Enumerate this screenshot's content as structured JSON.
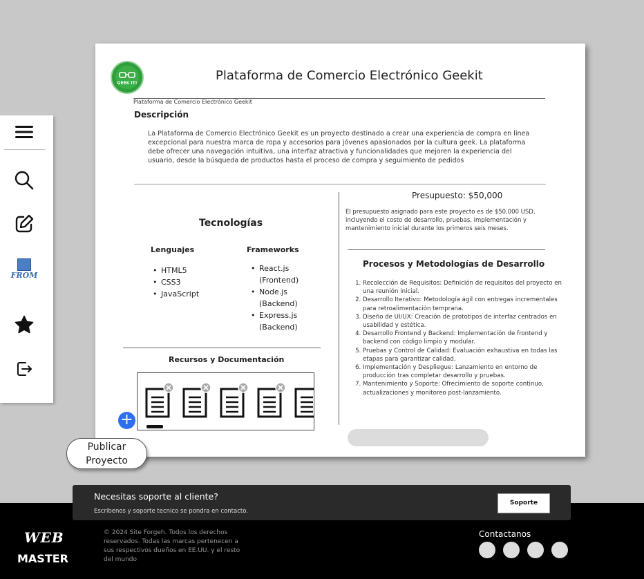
{
  "sidebar": {
    "items": [
      {
        "icon": "menu-icon"
      },
      {
        "icon": "search-icon"
      },
      {
        "icon": "edit-icon"
      },
      {
        "icon": "from-logo-icon",
        "label": "FROM"
      },
      {
        "icon": "star-icon"
      },
      {
        "icon": "logout-icon"
      }
    ]
  },
  "project": {
    "logo_text": "GEEK IT!",
    "title": "Plataforma de Comercio Electrónico Geekit",
    "subtitle": "Plataforma de Comercio Electrónico Geekit",
    "description_heading": "Descripción",
    "description": "La Plataforma de Comercio Electrónico Geekit es un proyecto destinado a crear una experiencia de compra en línea excepcional para nuestra marca de ropa y accesorios para jóvenes apasionados por la cultura geek. La plataforma debe ofrecer una navegación intuitiva, una interfaz atractiva y funcionalidades que mejoren la experiencia del usuario, desde la búsqueda de productos hasta el proceso de compra y seguimiento de pedidos",
    "tech_heading": "Tecnologías",
    "languages_heading": "Lenguajes",
    "languages": [
      "HTML5",
      "CSS3",
      "JavaScript"
    ],
    "frameworks_heading": "Frameworks",
    "frameworks": [
      "React.js (Frontend)",
      "Node.js (Backend)",
      "Express.js (Backend)"
    ],
    "resources_heading": "Recursos y Documentación",
    "budget_heading": "Presupuesto: $50,000",
    "budget_text": "El presupuesto asignado para este proyecto es de $50,000 USD, incluyendo el costo de desarrollo, pruebas, implementación y mantenimiento inicial durante los primeros seis meses.",
    "process_heading": "Procesos y Metodologías de Desarrollo",
    "process_steps": [
      "Recolección de Requisitos: Definición de requisitos del proyecto en una reunión inicial.",
      "Desarrollo Iterativo: Metodología ágil con entregas incrementales para retroalimentación temprana.",
      "Diseño de UI/UX: Creación de prototipos de interfaz centrados en usabilidad y estética.",
      "Desarrollo Frontend y Backend: Implementación de frontend y backend con código limpio y modular.",
      "Pruebas y Control de Calidad: Evaluación exhaustiva en todas las etapas para garantizar calidad.",
      "Implementación y Despliegue: Lanzamiento en entorno de producción tras completar desarrollo y pruebas.",
      "Mantenimiento y Soporte: Ofrecimiento de soporte continuo, actualizaciones y monitoreo post-lanzamiento."
    ],
    "add_label": "+"
  },
  "publish": {
    "line1": "Publicar",
    "line2": "Proyecto"
  },
  "support": {
    "title": "Necesitas soporte al cliente?",
    "subtitle": "Escribenos y soporte tecnico se pondra en contacto.",
    "button": "Soporte"
  },
  "footer": {
    "brand_top": "WEB",
    "brand_bottom": "MASTER",
    "copyright": "© 2024 Site Forgeh. Todos los derechos reservados. Todas las marcas pertenecen a sus respectivos dueños en EE.UU. y el resto del mundo",
    "contact_label": "Contactanos"
  },
  "colors": {
    "accent": "#2d6ff0",
    "logo_green": "#2e9f3a"
  }
}
